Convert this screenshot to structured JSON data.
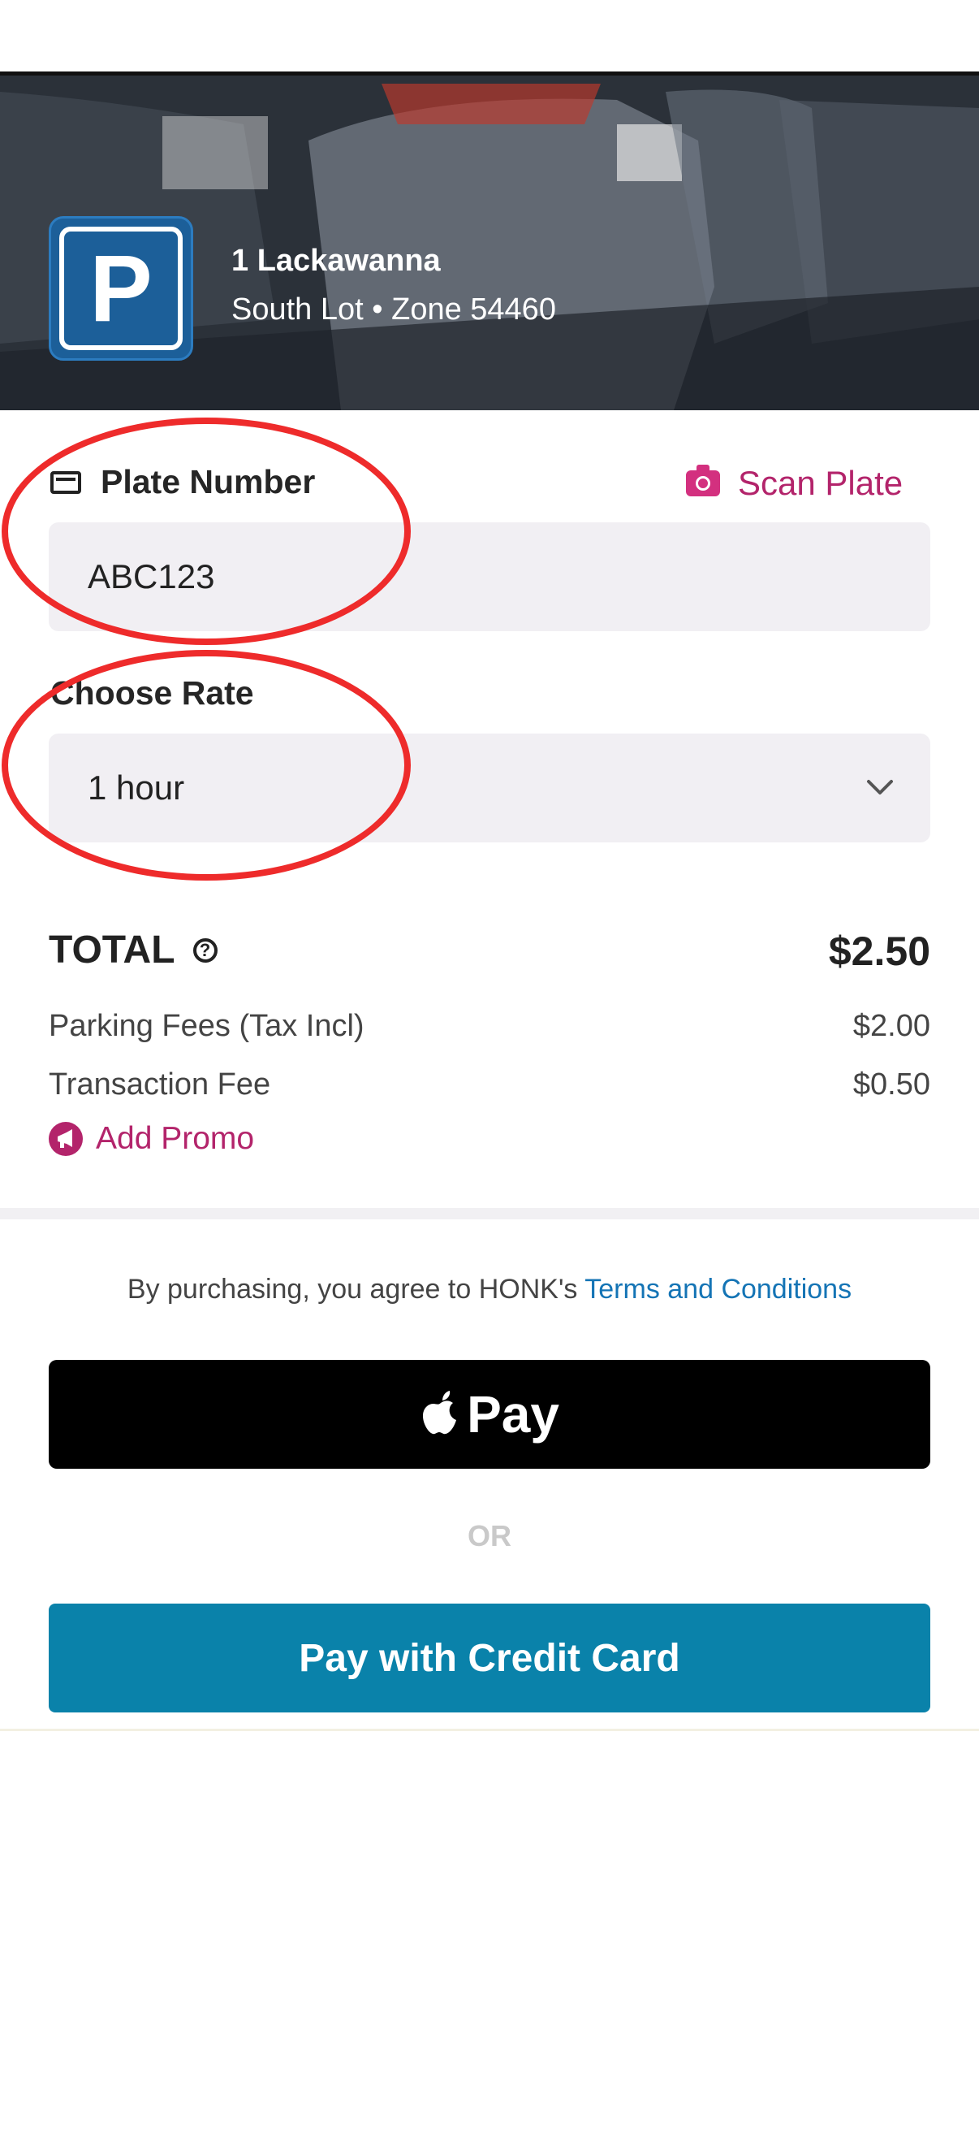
{
  "location": {
    "name": "1 Lackawanna",
    "subtitle": "South Lot • Zone 54460",
    "logo_letter": "P"
  },
  "plate": {
    "label": "Plate Number",
    "value": "ABC123",
    "scan_label": "Scan Plate"
  },
  "rate": {
    "label": "Choose Rate",
    "selected": "1 hour"
  },
  "summary": {
    "total_label": "TOTAL",
    "total_value": "$2.50",
    "help_glyph": "?",
    "rows": [
      {
        "label": "Parking Fees (Tax Incl)",
        "value": "$2.00"
      },
      {
        "label": "Transaction Fee",
        "value": "$0.50"
      }
    ],
    "promo_label": "Add Promo"
  },
  "terms": {
    "prefix": "By purchasing, you agree to HONK's ",
    "link": "Terms and Conditions"
  },
  "payment": {
    "applepay_label": "Pay",
    "or_label": "OR",
    "credit_card_label": "Pay with Credit Card"
  },
  "colors": {
    "accent_pink": "#b3246b",
    "link_blue": "#1474b5",
    "credit_button": "#0a82aa",
    "annotation_red": "#ee2b2b"
  },
  "icons": [
    "plate-icon",
    "camera-icon",
    "chevron-down-icon",
    "help-icon",
    "megaphone-icon",
    "apple-logo-icon"
  ]
}
